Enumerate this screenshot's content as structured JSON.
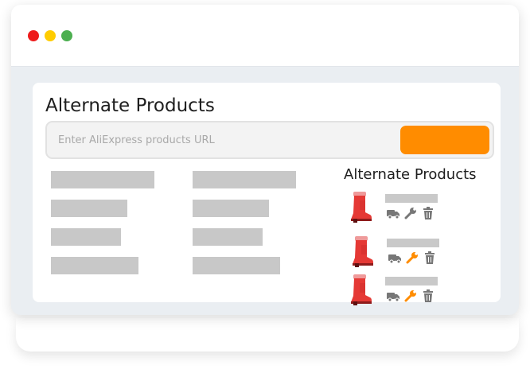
{
  "panel": {
    "title": "Alternate Products",
    "search": {
      "placeholder": "Enter AliExpress products URL",
      "value": "",
      "button_label": ""
    }
  },
  "sidebar": {
    "title": "Alternate Products",
    "items": [
      {
        "name": "",
        "icons": [
          "boot-icon",
          "truck-icon",
          "wrench-icon",
          "trash-icon"
        ]
      },
      {
        "name": "",
        "icons": [
          "boot-icon",
          "truck-icon",
          "wrench-icon",
          "trash-icon"
        ]
      },
      {
        "name": "",
        "icons": [
          "boot-icon",
          "truck-icon",
          "wrench-icon",
          "trash-icon"
        ]
      }
    ]
  },
  "colors": {
    "accent": "#ff8c00",
    "placeholder_block": "#c8c8c8",
    "icon_gray": "#777777",
    "boot_red": "#e53935",
    "window_close": "#ee1c1c",
    "window_minimize": "#ffcc00",
    "window_maximize": "#4caf50"
  }
}
